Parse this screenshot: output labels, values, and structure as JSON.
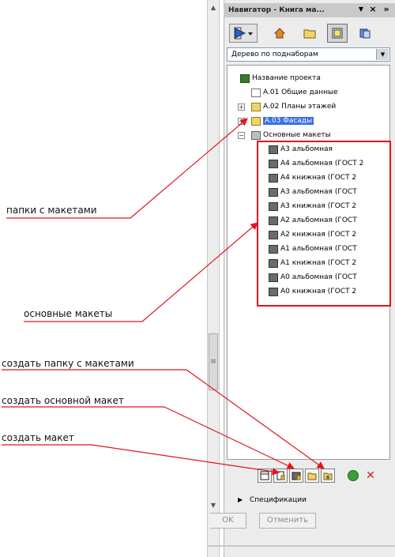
{
  "panel": {
    "title": "Навигатор - Книга ма...",
    "dropdown_value": "Дерево по поднаборам"
  },
  "tree": {
    "project_name": "Название проекта",
    "items": [
      "A.01 Общие данные",
      "A.02 Планы этажей",
      "A.03 Фасады",
      "Основные макеты"
    ],
    "master_layouts": [
      "A3 альбомная",
      "A4 альбомная (ГОСТ 2",
      "A4 книжная (ГОСТ 2",
      "A3 альбомная (ГОСТ",
      "A3 книжная (ГОСТ 2",
      "A2 альбомная (ГОСТ",
      "A2 книжная (ГОСТ 2",
      "A1 альбомная (ГОСТ",
      "A1 книжная (ГОСТ 2",
      "A0 альбомная (ГОСТ",
      "A0 книжная (ГОСТ 2"
    ]
  },
  "footer": {
    "specifications_label": "Спецификации",
    "ok_label": "OK",
    "cancel_label": "Отменить"
  },
  "annotations": {
    "folders": "папки с макетами",
    "main_layouts": "основные макеты",
    "create_folder": "создать папку с макетами",
    "create_main": "создать основной макет",
    "create_layout": "создать макет"
  },
  "colors": {
    "accent_red": "#e0151d",
    "selection_blue": "#3a6ee8"
  }
}
